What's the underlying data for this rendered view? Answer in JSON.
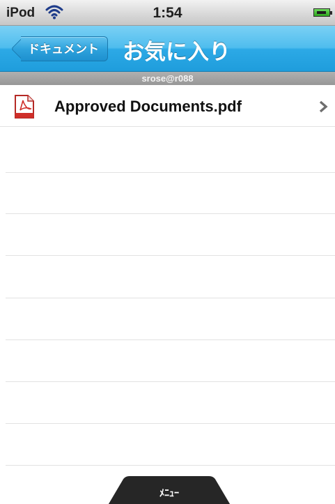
{
  "status_bar": {
    "device": "iPod",
    "time": "1:54",
    "wifi_icon": "wifi-icon",
    "battery_icon": "battery-charging-icon",
    "battery_color": "#3cbf2b"
  },
  "nav_bar": {
    "back_label": "ドキュメント",
    "title": "お気に入り",
    "bar_color": "#34adea"
  },
  "account": {
    "label": "srose@r088"
  },
  "files": [
    {
      "name": "Approved Documents.pdf",
      "icon": "pdf-icon",
      "accessory": "chevron-right-icon"
    }
  ],
  "menu_tab": {
    "label": "ﾒﾆｭｰ"
  }
}
